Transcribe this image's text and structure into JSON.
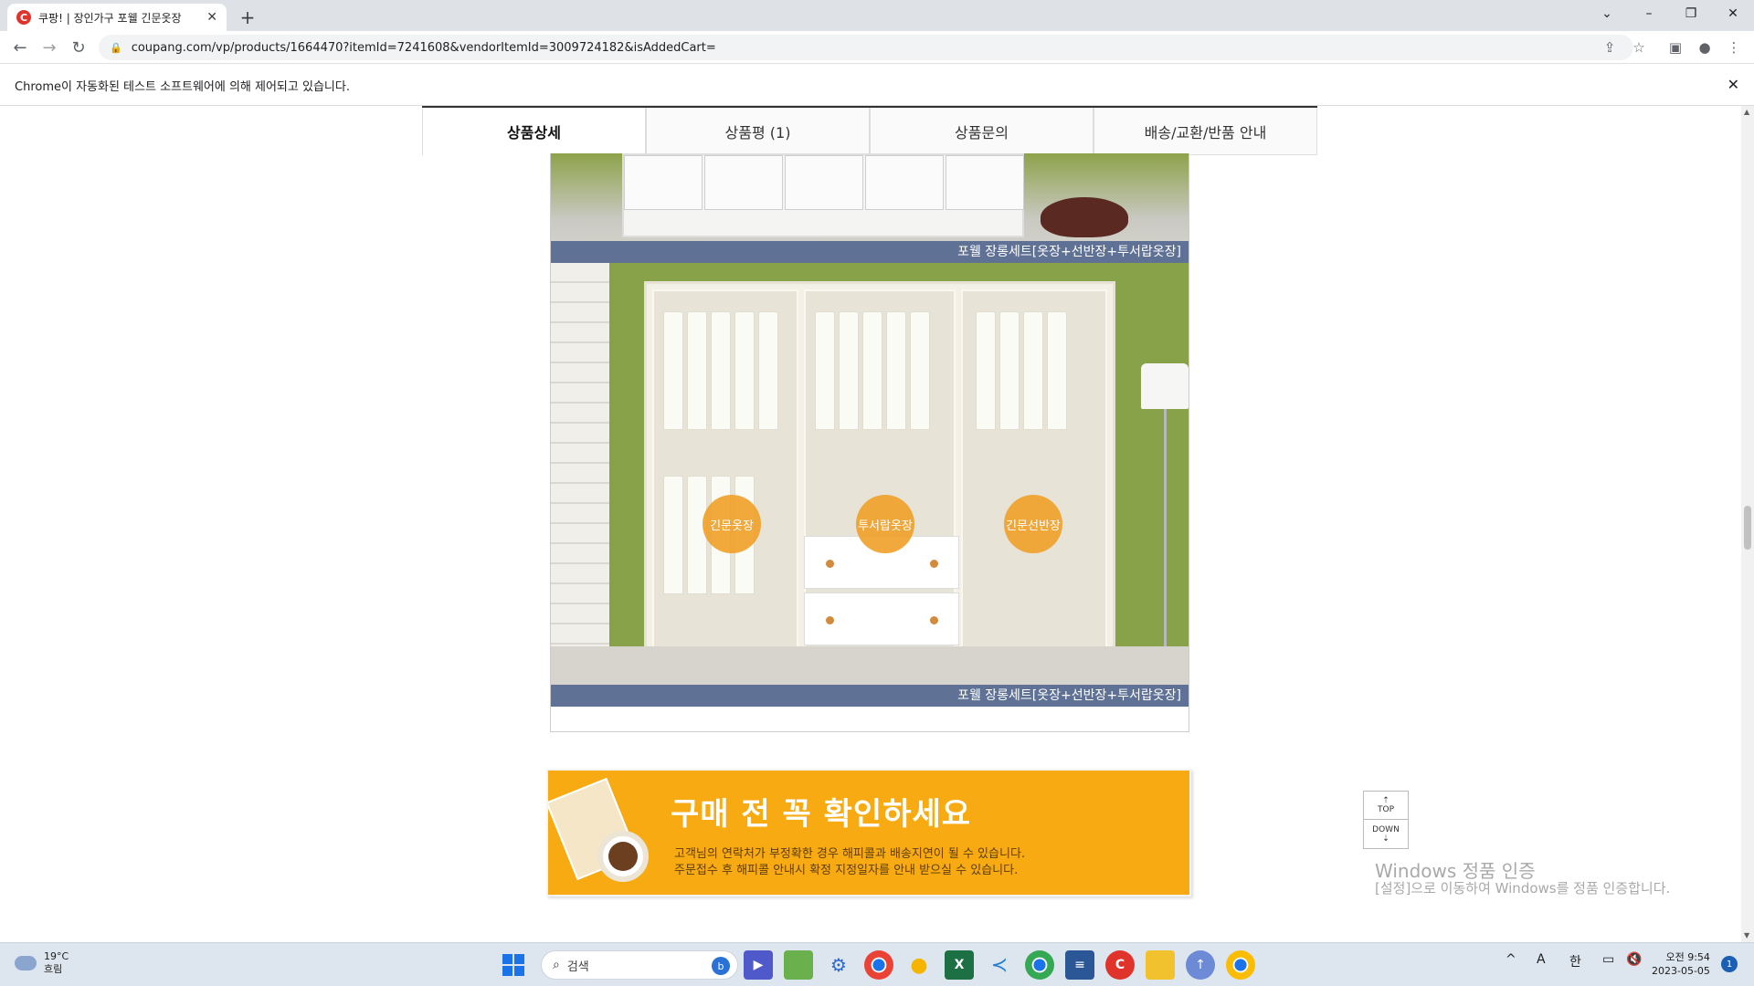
{
  "browser": {
    "tab_title": "쿠팡! | 장인가구 포웰 긴문옷장",
    "tab_favicon": "C",
    "url": "coupang.com/vp/products/1664470?itemId=7241608&vendorItemId=3009724182&isAddedCart=",
    "infobar_text": "Chrome이 자동화된 테스트 소프트웨어에 의해 제어되고 있습니다."
  },
  "product_tabs": [
    {
      "label": "상품상세",
      "active": true
    },
    {
      "label": "상품평 (1)",
      "active": false
    },
    {
      "label": "상품문의",
      "active": false
    },
    {
      "label": "배송/교환/반품 안내",
      "active": false
    }
  ],
  "detail": {
    "caption_1": "포웰 장롱세트[옷장+선반장+투서랍옷장]",
    "caption_2": "포웰 장롱세트[옷장+선반장+투서랍옷장]",
    "markers": [
      "긴문옷장",
      "투서랍옷장",
      "긴문선반장"
    ]
  },
  "banner": {
    "headline": "구매 전 꼭 확인하세요",
    "line1": "고객님의 연락처가 부정확한 경우 해피콜과 배송지연이 될 수 있습니다.",
    "line2": "주문접수 후 해피콜 안내시 확정 지정일자를 안내 받으실 수 있습니다.",
    "accent_color": "#f8aa12"
  },
  "scroll_buttons": {
    "top": "TOP",
    "down": "DOWN"
  },
  "watermark": {
    "title": "Windows 정품 인증",
    "subtitle": "[설정]으로 이동하여 Windows를 정품 인증합니다."
  },
  "taskbar": {
    "temperature": "19°C",
    "weather": "흐림",
    "search_placeholder": "검색",
    "ime_a": "A",
    "ime_han": "한",
    "time": "오전 9:54",
    "date": "2023-05-05",
    "notification_count": "1",
    "apps": [
      "start-icon",
      "teams-icon",
      "photos-icon",
      "settings-icon",
      "chrome-icon",
      "messenger-icon",
      "excel-icon",
      "vscode-icon",
      "chrome-icon",
      "notepad-icon",
      "coupang-icon",
      "file-explorer-icon",
      "store-icon",
      "chrome-icon"
    ]
  }
}
